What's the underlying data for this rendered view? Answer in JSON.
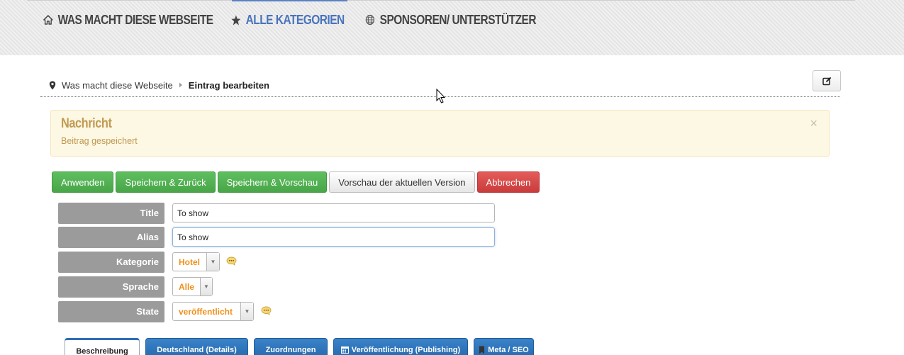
{
  "nav": {
    "items": [
      {
        "label": "WAS MACHT DIESE WEBSEITE",
        "icon": "home-icon"
      },
      {
        "label": "ALLE KATEGORIEN",
        "icon": "star-icon",
        "active": true
      },
      {
        "label": "SPONSOREN/ UNTERSTÜTZER",
        "icon": "globe-icon"
      }
    ],
    "colors": {
      "active": "#4a74bd",
      "default": "#444444"
    }
  },
  "breadcrumb": {
    "items": [
      "Was macht diese Webseite",
      "Eintrag bearbeiten"
    ],
    "icons": [
      "map-marker-icon",
      "caret-right-icon"
    ]
  },
  "message": {
    "title": "Nachricht",
    "text": "Beitrag gespeichert",
    "close": "×"
  },
  "toolbar": {
    "apply": "Anwenden",
    "save_back": "Speichern & Zurück",
    "save_preview": "Speichern & Vorschau",
    "preview_current": "Vorschau der aktuellen Version",
    "cancel": "Abbrechen",
    "colors": {
      "green": "#48a548",
      "red": "#c93c3b"
    }
  },
  "form": {
    "title_label": "Title",
    "title_value": "To show",
    "alias_label": "Alias",
    "alias_value": "To show",
    "category_label": "Kategorie",
    "category_value": "Hotel",
    "language_label": "Sprache",
    "language_value": "Alle",
    "state_label": "State",
    "state_value": "veröffentlicht",
    "highlight_color": "#f0901b"
  },
  "tabs": [
    {
      "label": "Beschreibung",
      "active": true
    },
    {
      "label": "Deutschland (Details)"
    },
    {
      "label": "Zuordnungen"
    },
    {
      "label": "Veröffentlichung (Publishing)",
      "icon": "calendar-icon"
    },
    {
      "label": "Meta / SEO",
      "icon": "bookmark-icon"
    }
  ]
}
